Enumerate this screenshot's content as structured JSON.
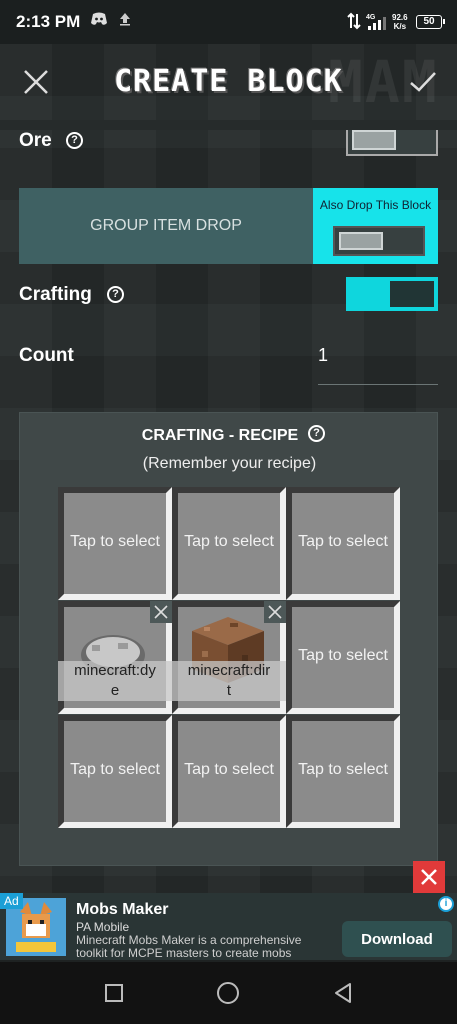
{
  "status_bar": {
    "time": "2:13 PM",
    "network_speed": "92.6",
    "network_unit": "K/s",
    "network_type": "4G",
    "battery": "50"
  },
  "header": {
    "title": "CREATE BLOCK",
    "watermark": "MAM",
    "close_icon": "close-icon",
    "confirm_icon": "check-icon"
  },
  "rows": {
    "ore_label": "Ore",
    "group_item_drop_label": "GROUP ITEM DROP",
    "also_drop_label": "Also Drop This Block",
    "crafting_label": "Crafting",
    "crafting_enabled": true,
    "count_label": "Count",
    "count_value": "1"
  },
  "recipe": {
    "title": "CRAFTING - RECIPE",
    "subtitle": "(Remember your recipe)",
    "slots": [
      {
        "label": "Tap to select"
      },
      {
        "label": "Tap to select"
      },
      {
        "label": "Tap to select"
      },
      {
        "item": "minecraft:dye",
        "line1": "minecraft:dy",
        "line2": "e"
      },
      {
        "item": "minecraft:dirt",
        "line1": "minecraft:dir",
        "line2": "t"
      },
      {
        "label": "Tap to select"
      },
      {
        "label": "Tap to select"
      },
      {
        "label": "Tap to select"
      },
      {
        "label": "Tap to select"
      }
    ]
  },
  "ad": {
    "badge": "Ad",
    "title": "Mobs Maker",
    "publisher": "PA Mobile",
    "description": "Minecraft Mobs Maker is a comprehensive toolkit for MCPE masters to create mobs",
    "button": "Download"
  },
  "colors": {
    "accent": "#17e3ea",
    "group_box": "#3f6163",
    "panel": "#404848",
    "ad_close": "#e13a3a"
  }
}
